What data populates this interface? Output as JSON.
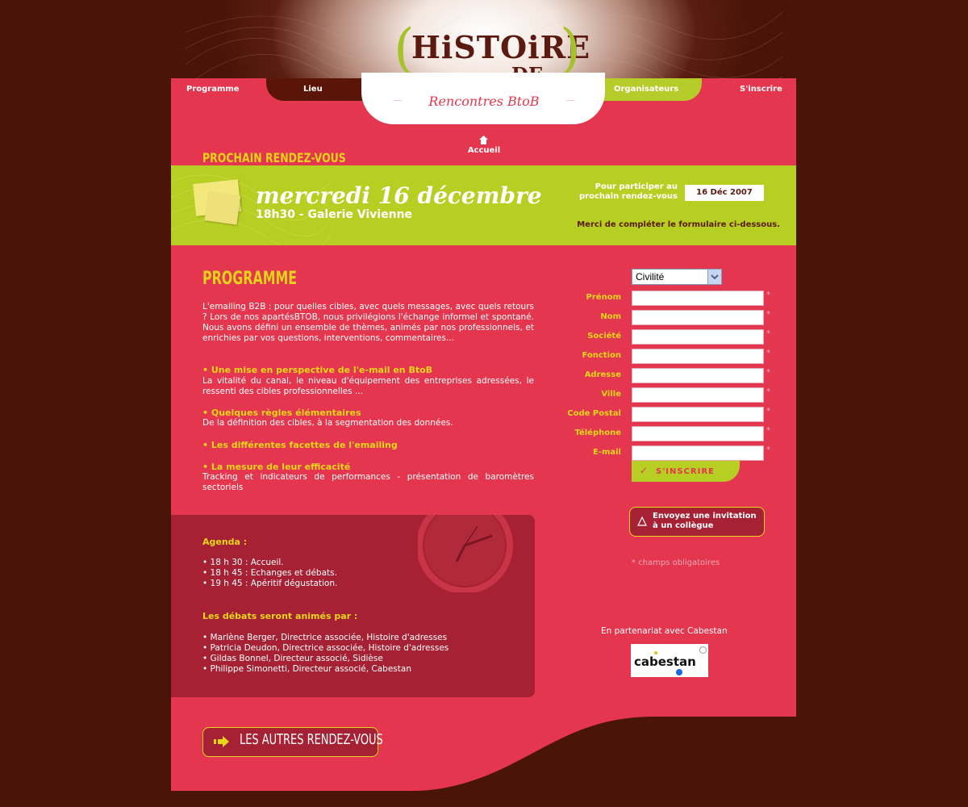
{
  "header": {
    "logo_main": "HiSTOiRE",
    "logo_sub": "DE...",
    "paren_open": "(",
    "paren_close": ")",
    "tagline": "Rencontres BtoB"
  },
  "nav": {
    "programme": "Programme",
    "lieu": "Lieu",
    "organisateurs": "Organisateurs",
    "inscrire": "S'inscrire",
    "accueil": "Accueil"
  },
  "event": {
    "heading": "PROCHAIN RENDEZ-VOUS",
    "date": "mercredi 16 décembre",
    "time_place": "18h30 - Galerie Vivienne",
    "participate": "Pour participer au prochain rendez-vous",
    "date_badge": "16 Déc 2007",
    "merci": "Merci de compléter le formulaire ci-dessous."
  },
  "programme": {
    "title": "PROGRAMME",
    "intro": "L'emailing B2B : pour quelles cibles, avec quels messages, avec quels retours ? Lors de nos apartésBTOB, nous privilégions l'échange informel et spontané. Nous avons défini un ensemble de thèmes, animés par nos professionnels, et enrichies par vos questions, interventions, commentaires...",
    "points": [
      {
        "title": "• Une mise en perspective de l'e-mail en BtoB",
        "text": "La vitalité du canal, le niveau d'équipement des entreprises adressées, le ressenti des cibles professionnelles ..."
      },
      {
        "title": "• Quelques règles élémentaires",
        "text": "De la définition des cibles, à la segmentation des données."
      },
      {
        "title": "• Les différentes facettes de l'emailing",
        "text": ""
      },
      {
        "title": "• La mesure de leur efficacité",
        "text": "Tracking et indicateurs de performances - présentation de baromètres sectoriels"
      }
    ]
  },
  "agenda": {
    "title": "Agenda :",
    "items": [
      "• 18 h 30 : Accueil.",
      "• 18 h 45 : Echanges et débats.",
      "• 19 h 45 : Apéritif dégustation."
    ],
    "speakers_title": "Les débats seront animés par :",
    "speakers": [
      "• Marlène Berger, Directrice associée, Histoire d'adresses",
      "• Patricia Deudon, Directrice associée, Histoire d'adresses",
      "• Gildas Bonnel, Directeur associé, Sidièse",
      "• Philippe Simonetti, Directeur associé, Cabestan"
    ]
  },
  "form": {
    "civilite": "Civilité",
    "fields": [
      "Prénom",
      "Nom",
      "Société",
      "Fonction",
      "Adresse",
      "Ville",
      "Code Postal",
      "Téléphone",
      "E-mail"
    ],
    "star": "*",
    "submit": "S'INSCRIRE",
    "invite": "Envoyez une invitation à un collègue",
    "required_note": "* champs obligatoires"
  },
  "partner": {
    "text": "En partenariat avec Cabestan",
    "logo": "cabestan"
  },
  "autres": "LES AUTRES RENDEZ-VOUS",
  "colors": {
    "background": "#4a1408",
    "main": "#e4364e",
    "green": "#b7cf22",
    "dark_red": "#a62134",
    "yellow": "#e8d61c"
  }
}
